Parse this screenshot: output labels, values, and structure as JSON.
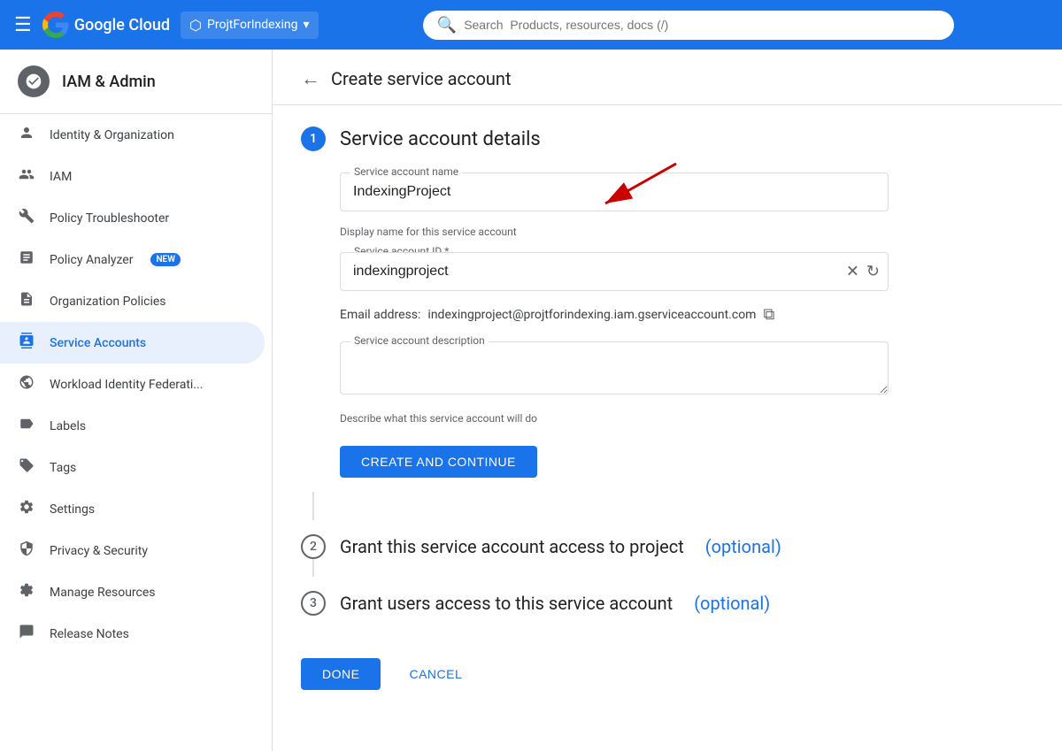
{
  "nav": {
    "menu_icon": "☰",
    "logo_text": "Google Cloud",
    "project_name": "ProjtForIndexing",
    "search_placeholder": "Search  Products, resources, docs (/)"
  },
  "sidebar": {
    "header_title": "IAM & Admin",
    "items": [
      {
        "id": "identity-org",
        "label": "Identity & Organization",
        "icon": "👤"
      },
      {
        "id": "iam",
        "label": "IAM",
        "icon": "👥"
      },
      {
        "id": "policy-troubleshooter",
        "label": "Policy Troubleshooter",
        "icon": "🔧"
      },
      {
        "id": "policy-analyzer",
        "label": "Policy Analyzer",
        "icon": "📋",
        "badge": "NEW"
      },
      {
        "id": "org-policies",
        "label": "Organization Policies",
        "icon": "📄"
      },
      {
        "id": "service-accounts",
        "label": "Service Accounts",
        "icon": "👤",
        "active": true
      },
      {
        "id": "workload-identity",
        "label": "Workload Identity Federati...",
        "icon": "📡"
      },
      {
        "id": "labels",
        "label": "Labels",
        "icon": "🏷️"
      },
      {
        "id": "tags",
        "label": "Tags",
        "icon": "▷"
      },
      {
        "id": "settings",
        "label": "Settings",
        "icon": "⚙️"
      },
      {
        "id": "privacy-security",
        "label": "Privacy & Security",
        "icon": "🔒"
      },
      {
        "id": "manage-resources",
        "label": "Manage Resources",
        "icon": "⚙️"
      },
      {
        "id": "release-notes",
        "label": "Release Notes",
        "icon": "📋"
      }
    ]
  },
  "page": {
    "back_label": "←",
    "title": "Create service account",
    "step1": {
      "number": "1",
      "title": "Service account details",
      "name_label": "Service account name",
      "name_value": "IndexingProject",
      "name_hint": "Display name for this service account",
      "id_label": "Service account ID *",
      "id_value": "indexingproject",
      "email_prefix": "Email address:",
      "email_value": "indexingproject@projtforindexing.iam.gserviceaccount.com",
      "desc_label": "Service account description",
      "desc_placeholder": "",
      "desc_hint": "Describe what this service account will do",
      "create_btn": "CREATE AND CONTINUE"
    },
    "step2": {
      "number": "2",
      "title": "Grant this service account access to project",
      "optional": "(optional)"
    },
    "step3": {
      "number": "3",
      "title": "Grant users access to this service account",
      "optional": "(optional)"
    },
    "done_btn": "DONE",
    "cancel_btn": "CANCEL"
  }
}
